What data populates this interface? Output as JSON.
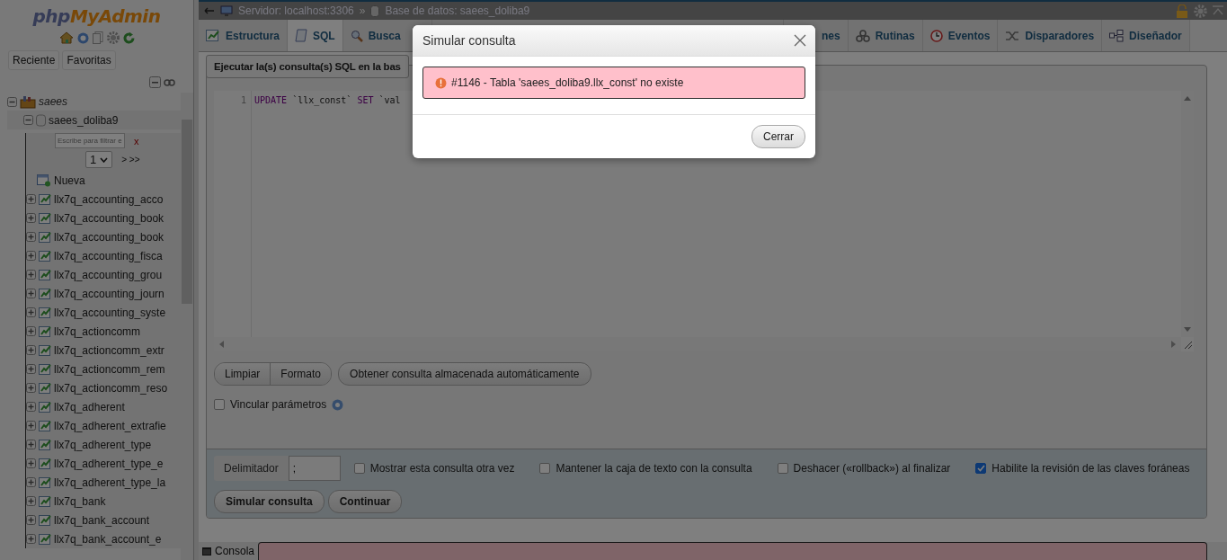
{
  "sidebar": {
    "logo": {
      "first": "php",
      "second": "MyAdmin"
    },
    "nav_buttons": [
      "Reciente",
      "Favoritas"
    ],
    "tree": {
      "label": "saees",
      "expanded": true,
      "database": {
        "label": "saees_doliba9",
        "expanded": true,
        "filter_placeholder": "Escribe para filtrar e",
        "filter_clear": "x",
        "page": "1",
        "page_nav": "> >>",
        "new_label": "Nueva",
        "tables": [
          {
            "label": "llx7q_accounting_acco",
            "expanded": false
          },
          {
            "label": "llx7q_accounting_book",
            "expanded": false
          },
          {
            "label": "llx7q_accounting_book",
            "expanded": false
          },
          {
            "label": "llx7q_accounting_fisca",
            "expanded": false
          },
          {
            "label": "llx7q_accounting_grou",
            "expanded": false
          },
          {
            "label": "llx7q_accounting_journ",
            "expanded": false
          },
          {
            "label": "llx7q_accounting_syste",
            "expanded": false
          },
          {
            "label": "llx7q_actioncomm",
            "expanded": false
          },
          {
            "label": "llx7q_actioncomm_extr",
            "expanded": false
          },
          {
            "label": "llx7q_actioncomm_rem",
            "expanded": false
          },
          {
            "label": "llx7q_actioncomm_reso",
            "expanded": false
          },
          {
            "label": "llx7q_adherent",
            "expanded": false
          },
          {
            "label": "llx7q_adherent_extrafie",
            "expanded": false
          },
          {
            "label": "llx7q_adherent_type",
            "expanded": false
          },
          {
            "label": "llx7q_adherent_type_e",
            "expanded": false
          },
          {
            "label": "llx7q_adherent_type_la",
            "expanded": false
          },
          {
            "label": "llx7q_bank",
            "expanded": false
          },
          {
            "label": "llx7q_bank_account",
            "expanded": false
          },
          {
            "label": "llx7q_bank_account_e",
            "expanded": false
          }
        ]
      }
    }
  },
  "breadcrumb": {
    "server": "Servidor: localhost:3306",
    "separator": "»",
    "database": "Base de datos: saees_doliba9"
  },
  "tabs": [
    {
      "label": "Estructura",
      "selected": false
    },
    {
      "label": "SQL",
      "selected": true
    },
    {
      "label": "Busca",
      "selected": false
    },
    {
      "label": "nes",
      "selected": false
    },
    {
      "label": "Rutinas",
      "selected": false
    },
    {
      "label": "Eventos",
      "selected": false
    },
    {
      "label": "Disparadores",
      "selected": false
    },
    {
      "label": "Diseñador",
      "selected": false
    }
  ],
  "sql_panel": {
    "title": "Ejecutar la(s) consulta(s) SQL en la bas",
    "line_number": "1",
    "code": [
      {
        "text": "UPDATE",
        "kind": "keyword"
      },
      {
        "text": " `llx_const` ",
        "kind": "name"
      },
      {
        "text": "SET",
        "kind": "keyword"
      },
      {
        "text": " `val",
        "kind": "name"
      }
    ],
    "buttons": [
      "Limpiar",
      "Formato"
    ],
    "stored_query_button": "Obtener consulta almacenada automáticamente",
    "bind_parameters": {
      "label": "Vincular parámetros",
      "checked": false
    }
  },
  "options": {
    "delimiter_label": "Delimitador",
    "delimiter_value": ";",
    "checkboxes": [
      {
        "label": "Mostrar esta consulta otra vez",
        "checked": false
      },
      {
        "label": "Mantener la caja de texto con la consulta",
        "checked": false
      },
      {
        "label": "Deshacer («rollback») al finalizar",
        "checked": false
      },
      {
        "label": "Habilite la revisión de las claves foráneas",
        "checked": true
      }
    ],
    "buttons": [
      "Simular consulta",
      "Continuar"
    ]
  },
  "console": {
    "label": "Consola"
  },
  "dialog": {
    "title": "Simular consulta",
    "error": "#1146 - Tabla 'saees_doliba9.llx_const' no existe",
    "button": "Cerrar"
  }
}
